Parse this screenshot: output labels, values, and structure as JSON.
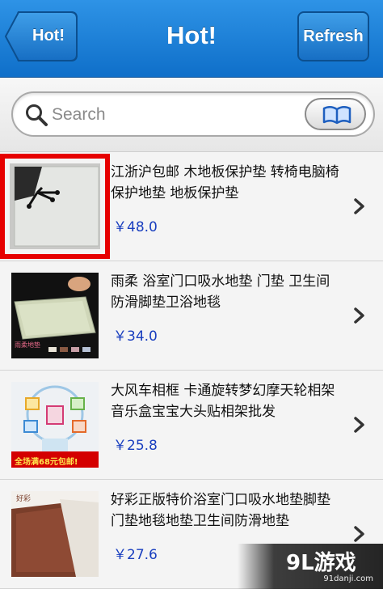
{
  "header": {
    "title": "Hot!",
    "back_label": "Hot!",
    "refresh_label": "Refresh"
  },
  "search": {
    "placeholder": "Search"
  },
  "products": [
    {
      "title": "江浙沪包邮 木地板保护垫 转椅电脑椅保护地垫 地板保护垫",
      "price": "￥48.0"
    },
    {
      "title": "雨柔 浴室门口吸水地垫 门垫 卫生间 防滑脚垫卫浴地毯",
      "price": "￥34.0",
      "thumb_caption": "雨柔地垫"
    },
    {
      "title": "大风车相框 卡通旋转梦幻摩天轮相架 音乐盒宝宝大头贴相架批发",
      "price": "￥25.8",
      "thumb_caption": "全场满68元包邮!"
    },
    {
      "title": "好彩正版特价浴室门口吸水地垫脚垫门垫地毯地垫卫生间防滑地垫",
      "price": "￥27.6",
      "thumb_caption": "好彩"
    }
  ],
  "watermark": {
    "logo": "9L游戏",
    "url": "91danji.com"
  },
  "colors": {
    "nav_blue": "#1f80d8",
    "price_blue": "#1a3fbf",
    "highlight_red": "#e60000"
  }
}
